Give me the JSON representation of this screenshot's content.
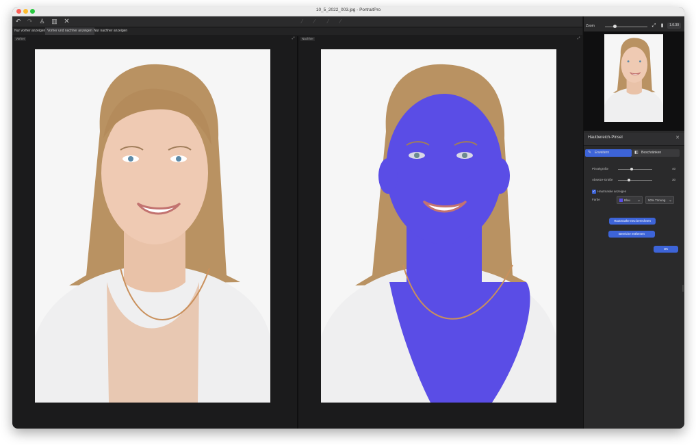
{
  "window": {
    "title": "10_5_2022_003.jpg - PortraitPro"
  },
  "toolbar": {
    "undo_icon": "undo-icon",
    "redo_icon": "redo-icon",
    "person_icon": "person-icon",
    "delete_icon": "trash-icon",
    "close_icon": "close-icon"
  },
  "view_tabs": [
    {
      "label": "Nur vorher anzeigen"
    },
    {
      "label": "Vorher und nachher anzeigen",
      "active": true
    },
    {
      "label": "Nur nachher anzeigen"
    }
  ],
  "panes": {
    "before_label": "Vorher",
    "after_label": "Nachher"
  },
  "navigator": {
    "zoom_label": "Zoom",
    "zoom_value": "1.0.30"
  },
  "skin_brush": {
    "title": "Hautbereich-Pinsel",
    "tab_expand": "Erweitern",
    "tab_reduce": "Beschränken",
    "size_label": "Pinselgröße",
    "size_value": "40",
    "softness_label": "Absetze-Größe",
    "softness_value": "30",
    "show_mask_label": "Hautmaske anzeigen",
    "color_label": "Farbe",
    "color_value": "Blau",
    "opacity_value": "50% Tönung",
    "recalc_button": "Hautmaske neu berechnen",
    "remove_button": "Bereiche entfernen",
    "ok_button": "OK"
  },
  "colors": {
    "accent": "#3d64d8",
    "mask": "#5a4de6",
    "background": "#1b1b1c"
  }
}
